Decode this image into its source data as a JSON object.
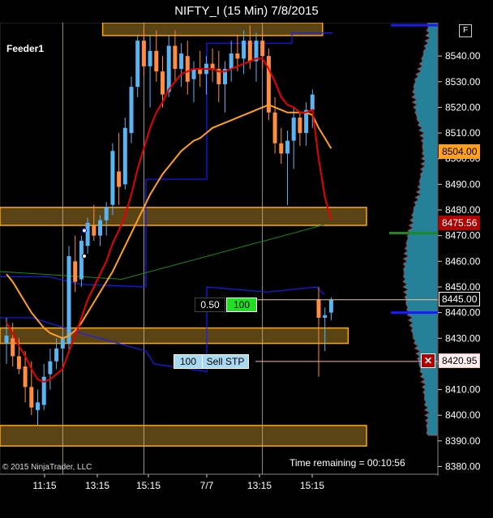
{
  "title": "NIFTY_I (15 Min)  7/8/2015",
  "panel_label": "Feeder1",
  "copyright": "© 2015 NinjaTrader, LLC",
  "time_remaining": "Time remaining = 00:10:56",
  "f_button": "F",
  "price_tags": {
    "sma": "8504.00",
    "ema": "8475.56",
    "last": "8445.00",
    "stop": "8420.95"
  },
  "order_entry": {
    "qty_limit": "0.50",
    "qty_fill": "100",
    "stop_qty": "100",
    "stop_label": "Sell STP"
  },
  "colors": {
    "bull": "#5ab4f0",
    "bear": "#ff8c40",
    "ema": "#e80000",
    "sma": "#ffa020",
    "blue_line": "#1a1aff",
    "green_line": "#1a8a1a",
    "zone_fill": "#5a4416",
    "zone_border": "#ffa600",
    "volume_profile": "#2a8fa8"
  },
  "chart_data": {
    "type": "candlestick",
    "title": "NIFTY_I (15 Min)  7/8/2015",
    "yticks": [
      8380,
      8390,
      8400,
      8410,
      8420,
      8430,
      8440,
      8450,
      8460,
      8470,
      8480,
      8490,
      8500,
      8510,
      8520,
      8530,
      8540
    ],
    "ylim": [
      8377,
      8553
    ],
    "xticks": [
      "11:15",
      "13:15",
      "15:15",
      "7/7",
      "13:15",
      "15:15"
    ],
    "candles": [
      {
        "o": 8428,
        "h": 8438,
        "l": 8420,
        "c": 8431
      },
      {
        "o": 8430,
        "h": 8436,
        "l": 8419,
        "c": 8423
      },
      {
        "o": 8423,
        "h": 8430,
        "l": 8416,
        "c": 8418
      },
      {
        "o": 8419,
        "h": 8425,
        "l": 8405,
        "c": 8411
      },
      {
        "o": 8411,
        "h": 8421,
        "l": 8400,
        "c": 8403
      },
      {
        "o": 8402,
        "h": 8410,
        "l": 8396,
        "c": 8405
      },
      {
        "o": 8404,
        "h": 8420,
        "l": 8402,
        "c": 8415
      },
      {
        "o": 8416,
        "h": 8426,
        "l": 8410,
        "c": 8421
      },
      {
        "o": 8421,
        "h": 8430,
        "l": 8418,
        "c": 8426
      },
      {
        "o": 8426,
        "h": 8432,
        "l": 8421,
        "c": 8430
      },
      {
        "o": 8428,
        "h": 8466,
        "l": 8424,
        "c": 8462
      },
      {
        "o": 8460,
        "h": 8470,
        "l": 8448,
        "c": 8452
      },
      {
        "o": 8453,
        "h": 8470,
        "l": 8450,
        "c": 8468
      },
      {
        "o": 8466,
        "h": 8477,
        "l": 8463,
        "c": 8475
      },
      {
        "o": 8474,
        "h": 8482,
        "l": 8468,
        "c": 8470
      },
      {
        "o": 8470,
        "h": 8478,
        "l": 8466,
        "c": 8476
      },
      {
        "o": 8476,
        "h": 8483,
        "l": 8470,
        "c": 8481
      },
      {
        "o": 8482,
        "h": 8506,
        "l": 8478,
        "c": 8503
      },
      {
        "o": 8495,
        "h": 8510,
        "l": 8482,
        "c": 8489
      },
      {
        "o": 8490,
        "h": 8516,
        "l": 8488,
        "c": 8512
      },
      {
        "o": 8510,
        "h": 8532,
        "l": 8506,
        "c": 8528
      },
      {
        "o": 8528,
        "h": 8548,
        "l": 8524,
        "c": 8546
      },
      {
        "o": 8546,
        "h": 8551,
        "l": 8532,
        "c": 8536
      },
      {
        "o": 8536,
        "h": 8548,
        "l": 8520,
        "c": 8542
      },
      {
        "o": 8542,
        "h": 8550,
        "l": 8530,
        "c": 8534
      },
      {
        "o": 8534,
        "h": 8540,
        "l": 8520,
        "c": 8525
      },
      {
        "o": 8526,
        "h": 8548,
        "l": 8524,
        "c": 8544
      },
      {
        "o": 8544,
        "h": 8550,
        "l": 8530,
        "c": 8535
      },
      {
        "o": 8535,
        "h": 8545,
        "l": 8528,
        "c": 8541
      },
      {
        "o": 8540,
        "h": 8546,
        "l": 8525,
        "c": 8530
      },
      {
        "o": 8531,
        "h": 8538,
        "l": 8522,
        "c": 8535
      },
      {
        "o": 8535,
        "h": 8542,
        "l": 8528,
        "c": 8533
      },
      {
        "o": 8533,
        "h": 8540,
        "l": 8525,
        "c": 8537
      },
      {
        "o": 8537,
        "h": 8543,
        "l": 8530,
        "c": 8535
      },
      {
        "o": 8535,
        "h": 8542,
        "l": 8522,
        "c": 8529
      },
      {
        "o": 8529,
        "h": 8538,
        "l": 8518,
        "c": 8535
      },
      {
        "o": 8535,
        "h": 8546,
        "l": 8530,
        "c": 8541
      },
      {
        "o": 8541,
        "h": 8548,
        "l": 8534,
        "c": 8539
      },
      {
        "o": 8539,
        "h": 8550,
        "l": 8533,
        "c": 8546
      },
      {
        "o": 8546,
        "h": 8552,
        "l": 8535,
        "c": 8538
      },
      {
        "o": 8538,
        "h": 8549,
        "l": 8530,
        "c": 8546
      },
      {
        "o": 8546,
        "h": 8550,
        "l": 8535,
        "c": 8540
      },
      {
        "o": 8540,
        "h": 8543,
        "l": 8515,
        "c": 8518
      },
      {
        "o": 8518,
        "h": 8524,
        "l": 8502,
        "c": 8506
      },
      {
        "o": 8506,
        "h": 8512,
        "l": 8498,
        "c": 8502
      },
      {
        "o": 8502,
        "h": 8511,
        "l": 8482,
        "c": 8507
      },
      {
        "o": 8507,
        "h": 8520,
        "l": 8496,
        "c": 8516
      },
      {
        "o": 8516,
        "h": 8518,
        "l": 8505,
        "c": 8510
      },
      {
        "o": 8510,
        "h": 8522,
        "l": 8505,
        "c": 8519
      },
      {
        "o": 8519,
        "h": 8527,
        "l": 8512,
        "c": 8525
      },
      {
        "o": 8445,
        "h": 8450,
        "l": 8415,
        "c": 8438
      },
      {
        "o": 8438,
        "h": 8442,
        "l": 8425,
        "c": 8439
      },
      {
        "o": 8440,
        "h": 8446,
        "l": 8437,
        "c": 8445
      }
    ],
    "ema": [
      8436,
      8432,
      8427,
      8423,
      8418,
      8414,
      8413,
      8414,
      8416,
      8418,
      8425,
      8431,
      8438,
      8445,
      8450,
      8455,
      8460,
      8467,
      8472,
      8478,
      8486,
      8496,
      8504,
      8512,
      8518,
      8522,
      8527,
      8530,
      8533,
      8534,
      8535,
      8535,
      8535,
      8535,
      8534,
      8534,
      8535,
      8536,
      8537,
      8538,
      8539,
      8539,
      8535,
      8530,
      8524,
      8521,
      8520,
      8518,
      8518,
      8519,
      8500,
      8485,
      8476
    ],
    "sma": [
      8455,
      8452,
      8448,
      8444,
      8440,
      8437,
      8434,
      8432,
      8431,
      8430,
      8431,
      8433,
      8436,
      8440,
      8444,
      8448,
      8452,
      8456,
      8461,
      8466,
      8471,
      8476,
      8481,
      8486,
      8490,
      8494,
      8497,
      8500,
      8503,
      8505,
      8507,
      8508,
      8510,
      8512,
      8513,
      8514,
      8515,
      8516,
      8517,
      8518,
      8519,
      8520,
      8521,
      8520,
      8519,
      8518,
      8518,
      8518,
      8518,
      8517,
      8512,
      8508,
      8504
    ],
    "zones": [
      {
        "top": 8553,
        "bottom": 8548,
        "x0": 0.28,
        "x1": 0.88
      },
      {
        "top": 8481,
        "bottom": 8474,
        "x0": 0,
        "x1": 1
      },
      {
        "top": 8434,
        "bottom": 8428,
        "x0": 0,
        "x1": 0.95
      },
      {
        "top": 8396,
        "bottom": 8388,
        "x0": 0,
        "x1": 1
      }
    ],
    "levels": {
      "last": 8445.0,
      "stop": 8420.95,
      "sma": 8504.0,
      "ema": 8475.56
    },
    "session_breaks": [
      9,
      22,
      41
    ]
  }
}
